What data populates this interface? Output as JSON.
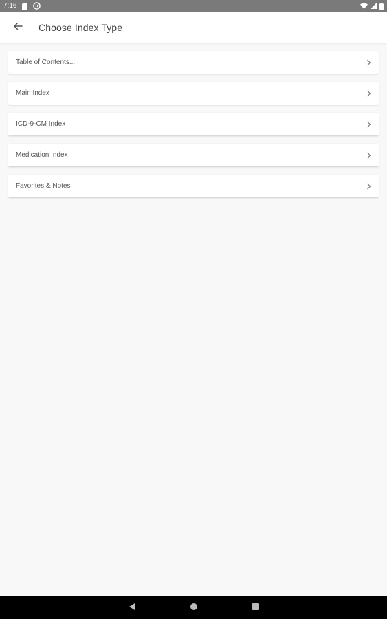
{
  "status_bar": {
    "time": "7:16",
    "icons": [
      "sd-card-icon",
      "sync-icon",
      "wifi-icon",
      "cell-signal-icon",
      "battery-icon"
    ]
  },
  "app_bar": {
    "title": "Choose Index Type",
    "back_icon": "arrow-left-icon"
  },
  "index_list": {
    "items": [
      {
        "label": "Table of Contents..."
      },
      {
        "label": "Main Index"
      },
      {
        "label": "ICD-9-CM Index"
      },
      {
        "label": "Medication Index"
      },
      {
        "label": "Favorites & Notes"
      }
    ]
  },
  "nav_bar": {
    "buttons": [
      "back-triangle-icon",
      "home-circle-icon",
      "recents-square-icon"
    ]
  },
  "colors": {
    "status_bar": "#7a7a7a",
    "background": "#f8f8f8",
    "card": "#ffffff",
    "nav_bar": "#000000"
  }
}
